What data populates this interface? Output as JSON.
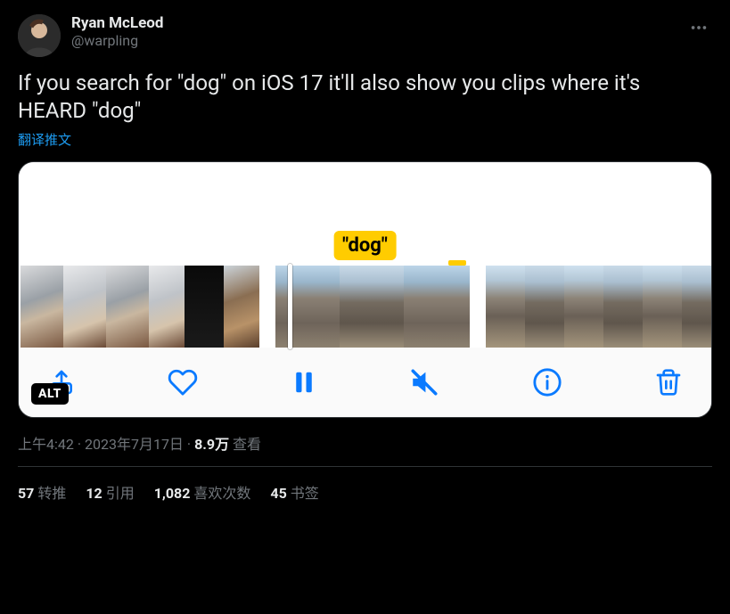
{
  "author": {
    "display_name": "Ryan McLeod",
    "handle": "@warpling"
  },
  "tweet_text": "If you search for \"dog\" on iOS 17 it'll also show you clips where it's HEARD \"dog\"",
  "translate_label": "翻译推文",
  "media": {
    "search_tag": "\"dog\"",
    "alt_badge": "ALT",
    "toolbar_icons": [
      "share-icon",
      "heart-icon",
      "pause-icon",
      "mute-icon",
      "info-icon",
      "trash-icon"
    ]
  },
  "meta": {
    "time": "上午4:42",
    "date": "2023年7月17日",
    "views_count": "8.9万",
    "views_label": "查看"
  },
  "stats": {
    "retweets_count": "57",
    "retweets_label": "转推",
    "quotes_count": "12",
    "quotes_label": "引用",
    "likes_count": "1,082",
    "likes_label": "喜欢次数",
    "bookmarks_count": "45",
    "bookmarks_label": "书签"
  }
}
